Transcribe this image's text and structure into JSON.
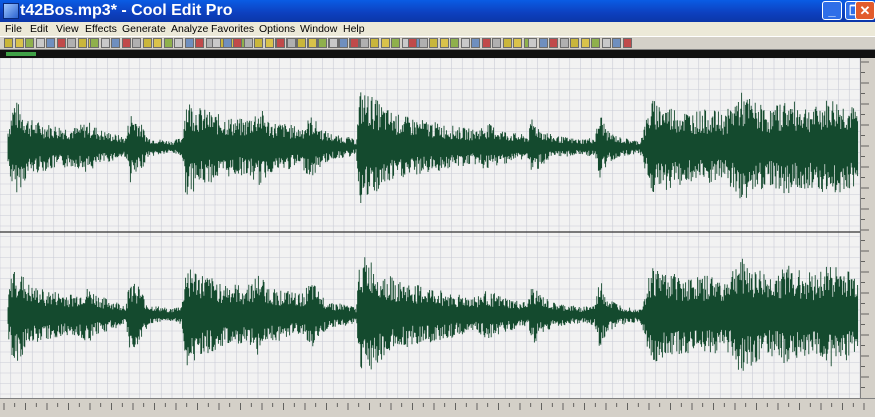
{
  "window": {
    "title": "t42Bos.mp3* - Cool Edit Pro",
    "minimize_glyph": "_",
    "maximize_glyph": "❐",
    "close_glyph": "✕"
  },
  "menu": [
    "File",
    "Edit",
    "View",
    "Effects",
    "Generate",
    "Analyze",
    "Favorites",
    "Options",
    "Window",
    "Help"
  ],
  "colors": {
    "waveform": "#144a2e",
    "wave_background": "#f2f2f2",
    "grid": "#c9ccd6",
    "overview_range": "#3fa047",
    "titlebar": "#0d47c8"
  },
  "icons": [
    "app-icon",
    "new-file-icon",
    "open-file-icon",
    "save-icon",
    "save-as-icon",
    "undo-icon",
    "redo-icon",
    "cut-icon",
    "copy-icon",
    "paste-icon",
    "zoom-in-icon",
    "zoom-out-icon",
    "play-icon",
    "stop-icon",
    "loop-icon",
    "record-icon"
  ],
  "view": {
    "channels": 2,
    "grid": true
  }
}
